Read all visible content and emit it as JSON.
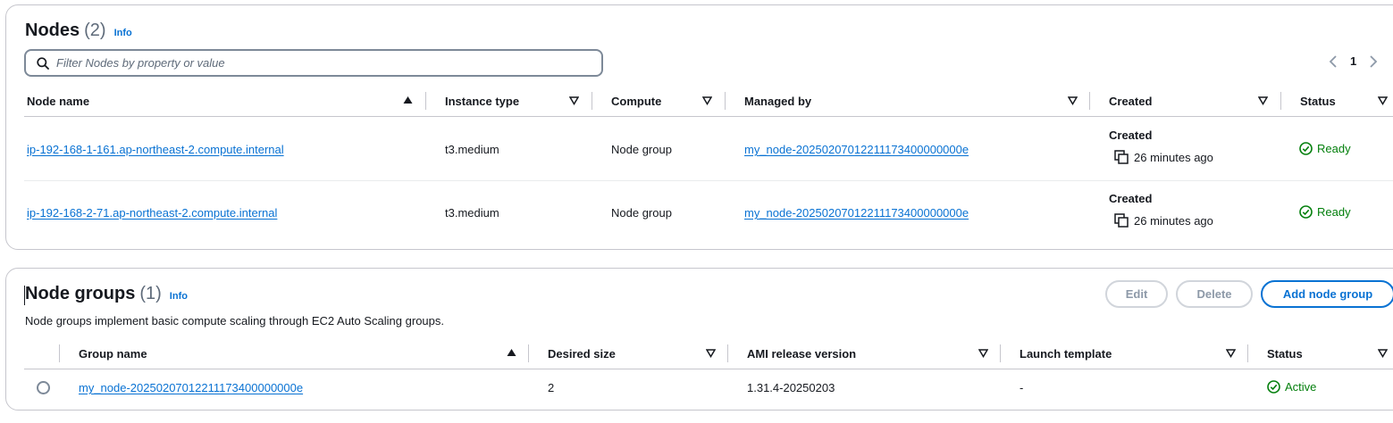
{
  "nodes": {
    "title": "Nodes",
    "count": "(2)",
    "info": "Info",
    "filter_placeholder": "Filter Nodes by property or value",
    "page": "1",
    "columns": [
      "Node name",
      "Instance type",
      "Compute",
      "Managed by",
      "Created",
      "Status"
    ],
    "rows": [
      {
        "name": "ip-192-168-1-161.ap-northeast-2.compute.internal",
        "instance_type": "t3.medium",
        "compute": "Node group",
        "managed_by": "my_node-20250207012211173400000000e",
        "created_label": "Created",
        "created": "26 minutes ago",
        "status": "Ready"
      },
      {
        "name": "ip-192-168-2-71.ap-northeast-2.compute.internal",
        "instance_type": "t3.medium",
        "compute": "Node group",
        "managed_by": "my_node-20250207012211173400000000e",
        "created_label": "Created",
        "created": "26 minutes ago",
        "status": "Ready"
      }
    ]
  },
  "node_groups": {
    "title": "Node groups",
    "count": "(1)",
    "info": "Info",
    "description": "Node groups implement basic compute scaling through EC2 Auto Scaling groups.",
    "buttons": {
      "edit": "Edit",
      "delete": "Delete",
      "add": "Add node group"
    },
    "columns": [
      "Group name",
      "Desired size",
      "AMI release version",
      "Launch template",
      "Status"
    ],
    "rows": [
      {
        "name": "my_node-20250207012211173400000000e",
        "desired_size": "2",
        "ami_version": "1.31.4-20250203",
        "launch_template": "-",
        "status": "Active"
      }
    ]
  },
  "colors": {
    "link": "#0972d3",
    "success": "#037f0c",
    "border": "#c6c6cd"
  },
  "icons": [
    "search-icon",
    "chevron-left-icon",
    "chevron-right-icon",
    "sort-asc-icon",
    "sort-desc-icon",
    "copy-icon",
    "status-ok-icon"
  ]
}
